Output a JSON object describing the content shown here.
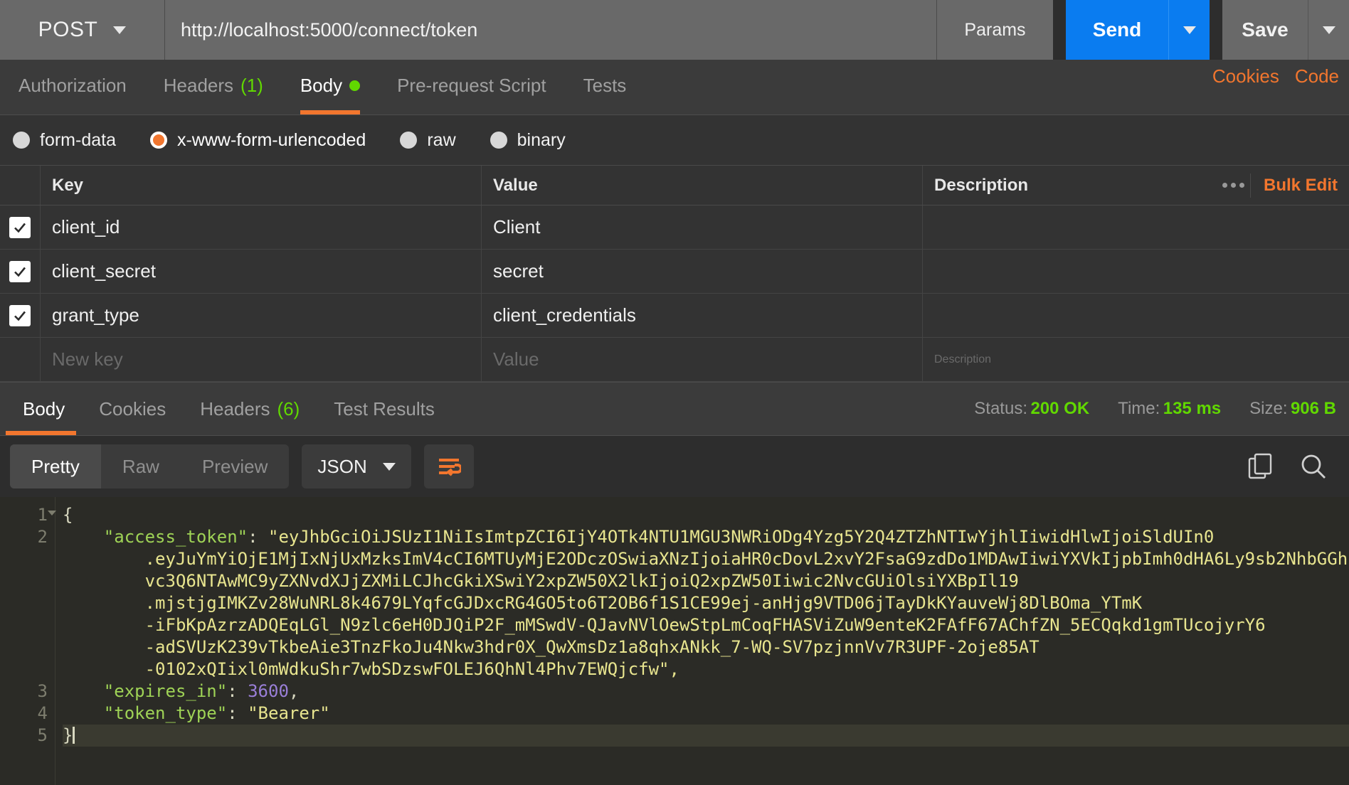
{
  "urlbar": {
    "method": "POST",
    "url": "http://localhost:5000/connect/token",
    "params_label": "Params",
    "send_label": "Send",
    "save_label": "Save"
  },
  "request_tabs": {
    "items": [
      {
        "label": "Authorization",
        "badge": "",
        "active": false
      },
      {
        "label": "Headers",
        "badge": "(1)",
        "active": false
      },
      {
        "label": "Body",
        "badge": "",
        "active": true
      },
      {
        "label": "Pre-request Script",
        "badge": "",
        "active": false
      },
      {
        "label": "Tests",
        "badge": "",
        "active": false
      }
    ],
    "links": [
      {
        "label": "Cookies"
      },
      {
        "label": "Code"
      }
    ]
  },
  "body_types": [
    {
      "label": "form-data",
      "selected": false
    },
    {
      "label": "x-www-form-urlencoded",
      "selected": true
    },
    {
      "label": "raw",
      "selected": false
    },
    {
      "label": "binary",
      "selected": false
    }
  ],
  "kv_table": {
    "headers": {
      "key": "Key",
      "value": "Value",
      "description": "Description"
    },
    "bulk_edit_label": "Bulk Edit",
    "rows": [
      {
        "checked": true,
        "key": "client_id",
        "value": "Client",
        "description": ""
      },
      {
        "checked": true,
        "key": "client_secret",
        "value": "secret",
        "description": ""
      },
      {
        "checked": true,
        "key": "grant_type",
        "value": "client_credentials",
        "description": ""
      }
    ],
    "new_row": {
      "key_placeholder": "New key",
      "value_placeholder": "Value",
      "description_placeholder": "Description"
    }
  },
  "response_tabs": {
    "items": [
      {
        "label": "Body",
        "badge": "",
        "active": true
      },
      {
        "label": "Cookies",
        "badge": "",
        "active": false
      },
      {
        "label": "Headers",
        "badge": "(6)",
        "active": false
      },
      {
        "label": "Test Results",
        "badge": "",
        "active": false
      }
    ],
    "meta": [
      {
        "label": "Status:",
        "value": "200 OK"
      },
      {
        "label": "Time:",
        "value": "135 ms"
      },
      {
        "label": "Size:",
        "value": "906 B"
      }
    ]
  },
  "response_toolbar": {
    "views": [
      {
        "label": "Pretty",
        "active": true
      },
      {
        "label": "Raw",
        "active": false
      },
      {
        "label": "Preview",
        "active": false
      }
    ],
    "format": "JSON",
    "wrap_icon": "word-wrap-icon",
    "copy_icon": "copy-icon",
    "search_icon": "search-icon"
  },
  "colors": {
    "accent_orange": "#f2762e",
    "send_blue": "#0a7cf0",
    "status_green": "#61d800",
    "code_bg": "#2b2b26",
    "string_yellow": "#e8e58f",
    "key_green": "#9fd356",
    "number_purple": "#9a7fd8"
  },
  "code": {
    "line_numbers": [
      "1",
      "2",
      "3",
      "4",
      "5"
    ],
    "json": {
      "access_token_key": "\"access_token\"",
      "access_token_value_segments": [
        "\"eyJhbGciOiJSUzI1NiIsImtpZCI6IjY4OTk4NTU1MGU3NWRiODg4Yzg5Y2Q4ZTZhNTIwYjhlIiwidHlwIjoiSldUIn0",
        ".eyJuYmYiOjE1MjIxNjUxMzksImV4cCI6MTUyMjE2ODczOSwiaXNzIjoiaHR0cDovL2xvY2FsaG9zdDo1MDAwIiwiYXVkIjpbImh0dHA6Ly9sb2NhbGGh",
        "vc3Q6NTAwMC9yZXNvdXJjZXMiLCJhcGkiXSwiY2xpZW50X2lkIjoiQ2xpZW50Iiwic2NvcGUiOlsiYXBpIl19",
        ".mjstjgIMKZv28WuNRL8k4679LYqfcGJDxcRG4GO5to6T2OB6f1S1CE99ej-anHjg9VTD06jTayDkKYauveWj8DlBOma_YTmK",
        "-iFbKpAzrzADQEqLGl_N9zlc6eH0DJQiP2F_mMSwdV-QJavNVlOewStpLmCoqFHASViZuW9enteK2FAfF67AChfZN_5ECQqkd1gmTUcojyrY6",
        "-adSVUzK239vTkbeAie3TnzFkoJu4Nkw3hdr0X_QwXmsDz1a8qhxANkk_7-WQ-SV7pzjnnVv7R3UPF-2oje85AT",
        "-0102xQIixl0mWdkuShr7wbSDzswFOLEJ6QhNl4Phv7EWQjcfw\","
      ],
      "expires_in_key": "\"expires_in\"",
      "expires_in_value": "3600",
      "token_type_key": "\"token_type\"",
      "token_type_value": "\"Bearer\"",
      "open_brace": "{",
      "close_brace": "}"
    }
  }
}
